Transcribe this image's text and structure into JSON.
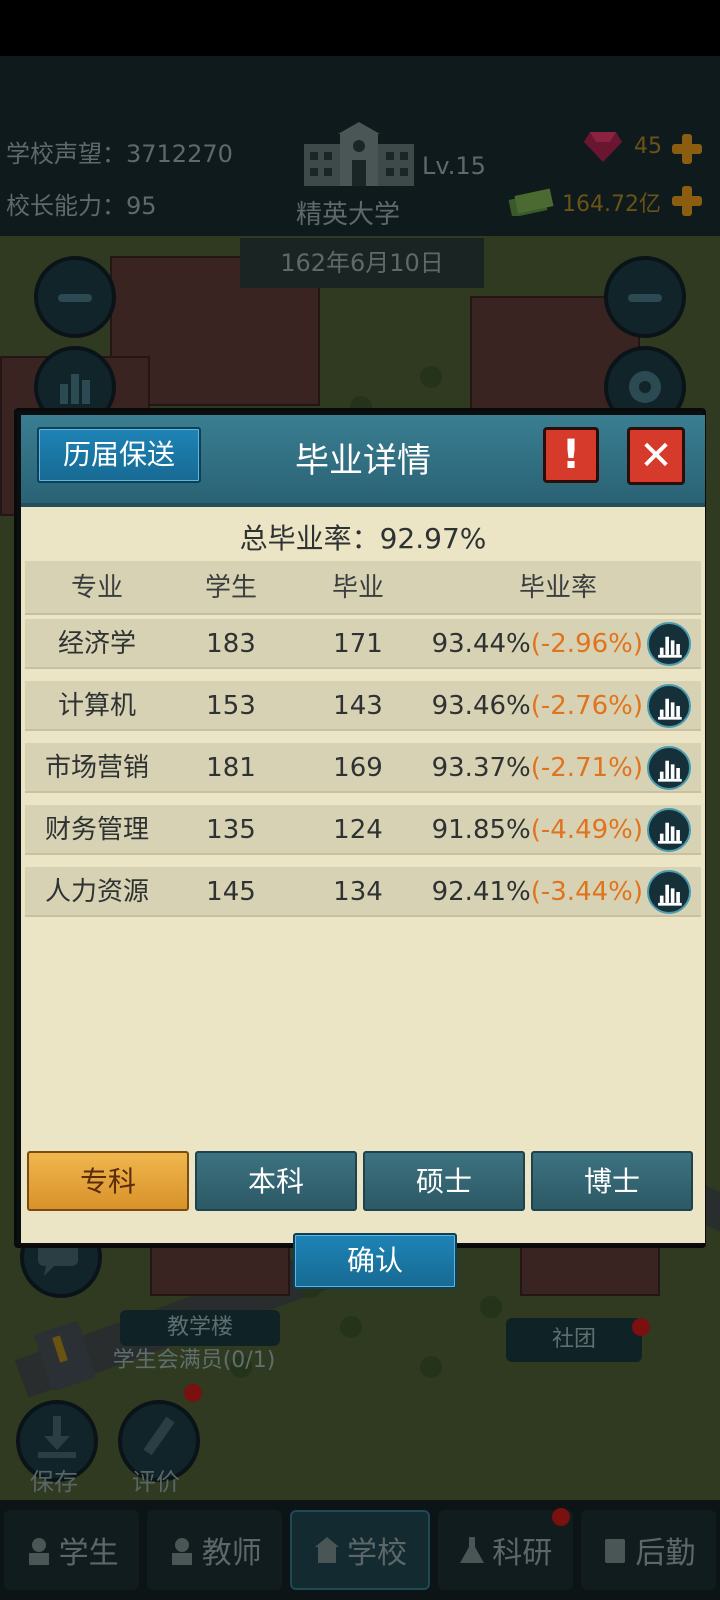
{
  "hud": {
    "reputation": "学校声望：3712270",
    "ability": "校长能力：95",
    "level": "Lv.15",
    "school_name": "精英大学",
    "gems": "45",
    "money": "164.72亿",
    "date": "162年6月10日"
  },
  "map_labels": {
    "teaching_building": "教学楼",
    "council": "学生会满员(0/1)",
    "club": "社团",
    "save": "保存",
    "review": "评价"
  },
  "modal": {
    "history_button": "历届保送",
    "title": "毕业详情",
    "info_label": "!",
    "close_label": "✕",
    "total_rate": "总毕业率：92.97%",
    "headers": [
      "专业",
      "学生",
      "毕业",
      "毕业率"
    ],
    "rows": [
      {
        "major": "经济学",
        "students": "183",
        "graduates": "171",
        "rate": "93.44%",
        "delta": "(-2.96%)"
      },
      {
        "major": "计算机",
        "students": "153",
        "graduates": "143",
        "rate": "93.46%",
        "delta": "(-2.76%)"
      },
      {
        "major": "市场营销",
        "students": "181",
        "graduates": "169",
        "rate": "93.37%",
        "delta": "(-2.71%)"
      },
      {
        "major": "财务管理",
        "students": "135",
        "graduates": "124",
        "rate": "91.85%",
        "delta": "(-4.49%)"
      },
      {
        "major": "人力资源",
        "students": "145",
        "graduates": "134",
        "rate": "92.41%",
        "delta": "(-3.44%)"
      }
    ],
    "tabs": [
      "专科",
      "本科",
      "硕士",
      "博士"
    ],
    "active_tab": "专科",
    "confirm_button": "确认"
  },
  "nav": {
    "items": [
      "学生",
      "教师",
      "学校",
      "科研",
      "后勤"
    ],
    "active": "学校"
  },
  "colors": {
    "accent_blue": "#1e84b6",
    "tab_active": "#f0b64e",
    "delta_orange": "#e0741e",
    "panel_bg": "#ebe5c5"
  }
}
